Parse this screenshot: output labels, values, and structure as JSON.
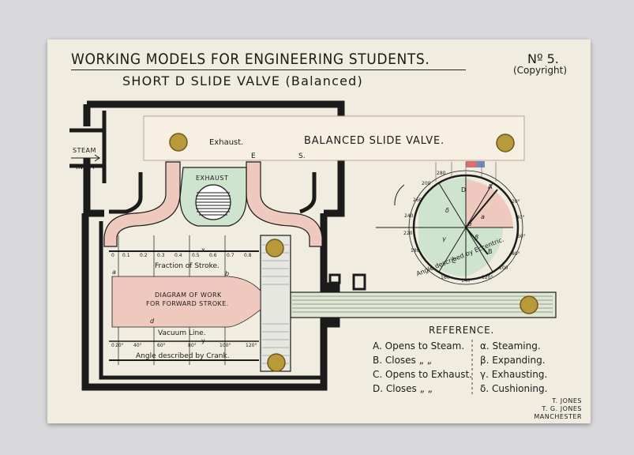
{
  "header": {
    "title": "WORKING MODELS FOR ENGINEERING STUDENTS.",
    "subtitle": "SHORT D SLIDE VALVE (Balanced)",
    "number": "Nº 5.",
    "copyright": "(Copyright)"
  },
  "diagram": {
    "steam_inlet": [
      "STEAM",
      "INLET"
    ],
    "exhaust_valve": "Exhaust.",
    "exhaust_port": "EXHAUST",
    "slider_label": "BALANCED SLIDE VALVE.",
    "port_letters": [
      "E",
      "S."
    ],
    "fraction_label": "Fraction of Stroke.",
    "fraction_ticks": [
      "0",
      "0.1",
      "0.2",
      "0.3",
      "0.4",
      "0.5",
      "0.6",
      "0.7",
      "0.8"
    ],
    "work_label": [
      "DIAGRAM OF WORK",
      "FOR FORWARD STROKE."
    ],
    "vacuum_label": "Vacuum Line.",
    "crank_label": "Angle described by Crank.",
    "crank_ticks": [
      "0",
      "20°",
      "40°",
      "60°",
      "80°",
      "100°",
      "120°"
    ],
    "diagram_letters": [
      "a",
      "b",
      "d",
      "x",
      "y"
    ],
    "eccentric_label": "Angle described by Eccentric.",
    "eccentric_ticks": [
      "200",
      "220",
      "240",
      "260",
      "280",
      "20°",
      "40°",
      "60°",
      "80°",
      "100",
      "120°",
      "140°",
      "160",
      "180"
    ],
    "eccentric_letters": [
      "A",
      "B",
      "C",
      "D",
      "a",
      "β",
      "γ",
      "δ",
      "O"
    ]
  },
  "reference": {
    "title": "REFERENCE.",
    "left": [
      "A. Opens to Steam.",
      "B. Closes  „  „",
      "C. Opens to Exhaust.",
      "D. Closes  „  „"
    ],
    "right": [
      "α. Steaming.",
      "β. Expanding.",
      "γ. Exhausting.",
      "δ. Cushioning."
    ]
  },
  "maker": [
    "T. JONES",
    "T. G. JONES",
    "MANCHESTER"
  ],
  "colors": {
    "card": "#f0ecdf",
    "pink": "#f0c9be",
    "green": "#cfe4cf",
    "black": "#1b1b1b",
    "brass": "#b89a3a",
    "red": "#c94a4a",
    "blue": "#4a68b8"
  }
}
